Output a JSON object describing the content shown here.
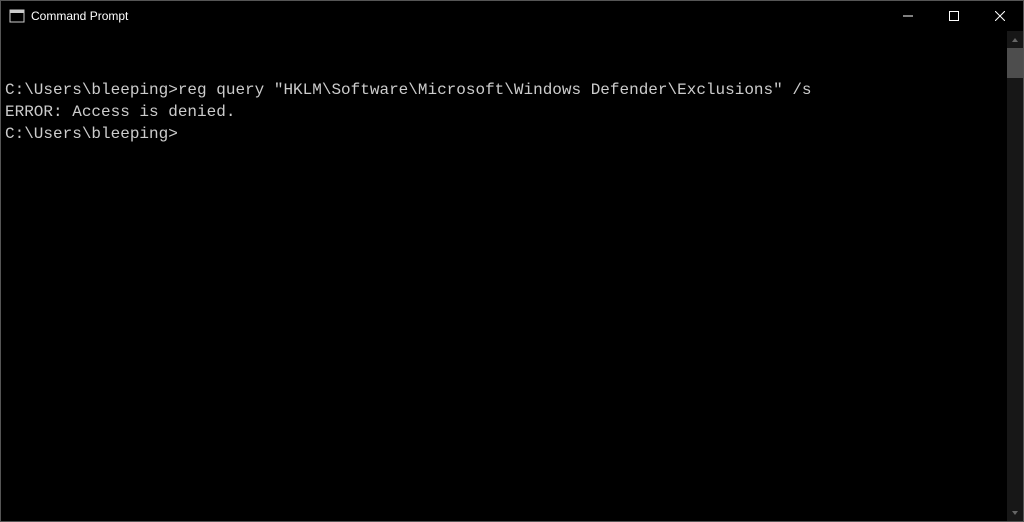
{
  "window": {
    "title": "Command Prompt"
  },
  "terminal": {
    "blank_top": "",
    "line1_prompt": "C:\\Users\\bleeping>",
    "line1_command": "reg query \"HKLM\\Software\\Microsoft\\Windows Defender\\Exclusions\" /s",
    "line2_output": "ERROR: Access is denied.",
    "line3_blank": "",
    "line4_prompt": "C:\\Users\\bleeping>"
  }
}
